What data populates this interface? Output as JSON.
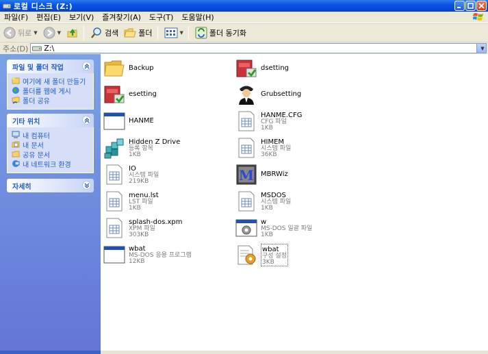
{
  "window": {
    "title": "로컬 디스크 (Z:)"
  },
  "menu": [
    "파일(F)",
    "편집(E)",
    "보기(V)",
    "즐겨찾기(A)",
    "도구(T)",
    "도움말(H)"
  ],
  "toolbar": {
    "back": "뒤로",
    "search": "검색",
    "folders": "폴더",
    "sync": "폴더 동기화"
  },
  "address": {
    "label": "주소(D)",
    "value": "Z:\\"
  },
  "tasks_panel": {
    "title": "파일 및 폴더 작업",
    "items": [
      "여기에 새 폴더 만들기",
      "폴더를 웹에 게시",
      "폴더 공유"
    ]
  },
  "places_panel": {
    "title": "기타 위치",
    "items": [
      "내 컴퓨터",
      "내 문서",
      "공유 문서",
      "내 네트워크 환경"
    ]
  },
  "details_panel": {
    "title": "자세히"
  },
  "files": [
    {
      "name": "Backup",
      "sub1": "",
      "sub2": "",
      "icon": "folder-icon"
    },
    {
      "name": "dsetting",
      "sub1": "",
      "sub2": "",
      "icon": "installer-icon"
    },
    {
      "name": "esetting",
      "sub1": "",
      "sub2": "",
      "icon": "installer-icon"
    },
    {
      "name": "Grubsetting",
      "sub1": "",
      "sub2": "",
      "icon": "user-icon"
    },
    {
      "name": "HANME",
      "sub1": "",
      "sub2": "",
      "icon": "window-icon"
    },
    {
      "name": "HANME.CFG",
      "sub1": "CFG 파일",
      "sub2": "1KB",
      "icon": "document-icon"
    },
    {
      "name": "Hidden Z Drive",
      "sub1": "등록 항목",
      "sub2": "1KB",
      "icon": "registry-icon"
    },
    {
      "name": "HIMEM",
      "sub1": "시스템 파일",
      "sub2": "36KB",
      "icon": "document-icon"
    },
    {
      "name": "IO",
      "sub1": "시스템 파일",
      "sub2": "219KB",
      "icon": "document-icon"
    },
    {
      "name": "MBRWiz",
      "sub1": "",
      "sub2": "",
      "icon": "mbrwiz-icon"
    },
    {
      "name": "menu.lst",
      "sub1": "LST 파일",
      "sub2": "1KB",
      "icon": "document-icon"
    },
    {
      "name": "MSDOS",
      "sub1": "시스템 파일",
      "sub2": "1KB",
      "icon": "document-icon"
    },
    {
      "name": "splash-dos.xpm",
      "sub1": "XPM 파일",
      "sub2": "303KB",
      "icon": "document-icon"
    },
    {
      "name": "w",
      "sub1": "MS-DOS 일괄 파일",
      "sub2": "1KB",
      "icon": "batch-icon"
    },
    {
      "name": "wbat",
      "sub1": "MS-DOS 응용 프로그램",
      "sub2": "12KB",
      "icon": "window-icon"
    },
    {
      "name": "wbat",
      "sub1": "구성 설정",
      "sub2": "3KB",
      "icon": "config-settings-icon"
    }
  ]
}
